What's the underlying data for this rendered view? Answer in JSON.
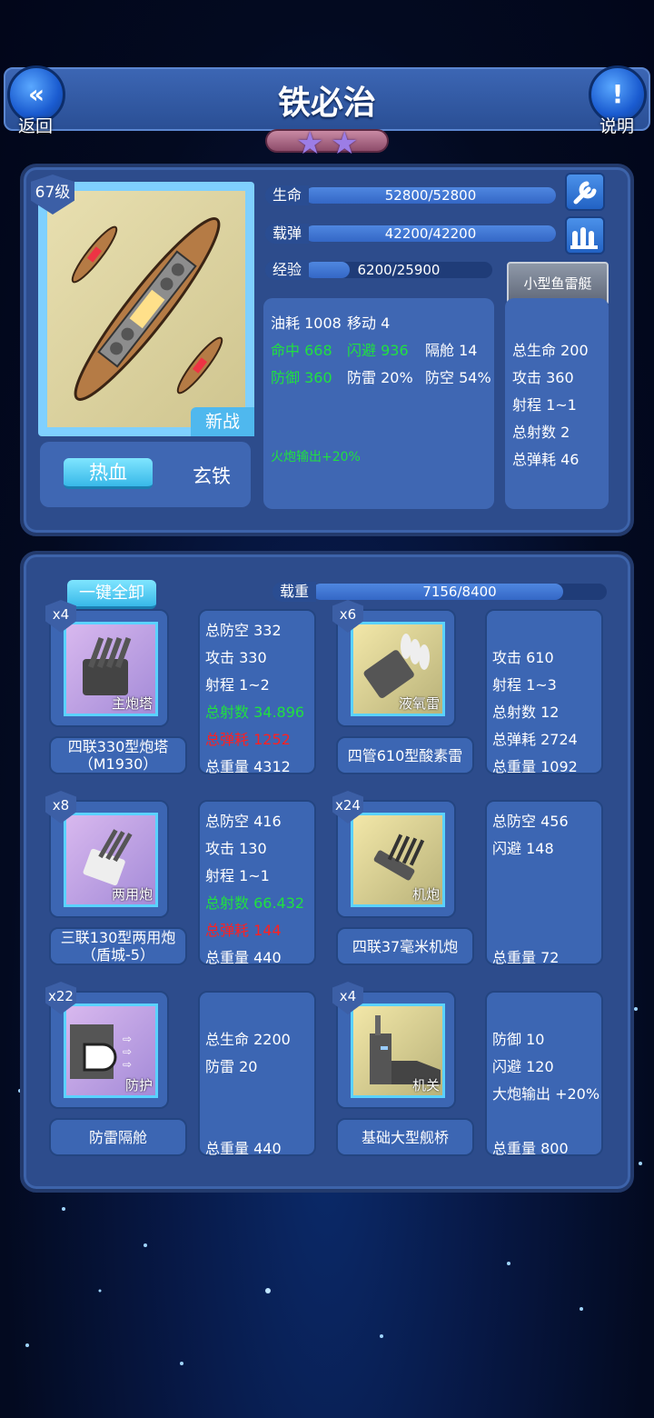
{
  "header": {
    "title": "铁必治",
    "back_label": "返回",
    "help_label": "说明",
    "star_count": 2
  },
  "ship": {
    "level": "67级",
    "tag": "新战",
    "buttons": {
      "active": "热血",
      "other": "玄铁"
    },
    "bars": [
      {
        "label": "生命",
        "value": "52800/52800",
        "ratio": 1.0
      },
      {
        "label": "载弹",
        "value": "42200/42200",
        "ratio": 1.0
      },
      {
        "label": "经验",
        "value": "6200/25900",
        "ratio": 0.24
      }
    ],
    "stats": {
      "fuel": "油耗 1008",
      "move": "移动 4",
      "hit": "命中 668",
      "dodge": "闪避 936",
      "compartment": "隔舱 14",
      "defense": "防御 360",
      "mine_def": "防雷 20%",
      "aa": "防空 54%",
      "bonus": "火炮输出+20%"
    },
    "escort": {
      "button": "小型鱼雷艇",
      "stats": [
        "总生命 200",
        "攻击 360",
        "射程 1~1",
        "总射数 2",
        "总弹耗 46"
      ]
    }
  },
  "equipment": {
    "unload_all": "一键全卸",
    "load_label": "载重",
    "load_value": "7156/8400",
    "load_ratio": 0.852,
    "items": [
      {
        "count": "x4",
        "category": "主炮塔",
        "name": "四联330型炮塔（M1930）",
        "stats": [
          {
            "t": "总防空 332",
            "c": ""
          },
          {
            "t": "攻击 330",
            "c": ""
          },
          {
            "t": "射程 1~2",
            "c": ""
          },
          {
            "t": "总射数 34.896",
            "c": "g"
          },
          {
            "t": "总弹耗 1252",
            "c": "r"
          },
          {
            "t": "总重量 4312",
            "c": ""
          }
        ]
      },
      {
        "count": "x6",
        "category": "液氧雷",
        "name": "四管610型酸素雷",
        "stats": [
          {
            "t": "",
            "c": ""
          },
          {
            "t": "攻击 610",
            "c": ""
          },
          {
            "t": "射程 1~3",
            "c": ""
          },
          {
            "t": "总射数 12",
            "c": ""
          },
          {
            "t": "总弹耗 2724",
            "c": ""
          },
          {
            "t": "总重量 1092",
            "c": ""
          }
        ]
      },
      {
        "count": "x8",
        "category": "两用炮",
        "name": "三联130型两用炮（盾城-5）",
        "stats": [
          {
            "t": "总防空 416",
            "c": ""
          },
          {
            "t": "攻击 130",
            "c": ""
          },
          {
            "t": "射程 1~1",
            "c": ""
          },
          {
            "t": "总射数 66.432",
            "c": "g"
          },
          {
            "t": "总弹耗 144",
            "c": "r"
          },
          {
            "t": "总重量 440",
            "c": ""
          }
        ]
      },
      {
        "count": "x24",
        "category": "机炮",
        "name": "四联37毫米机炮",
        "stats": [
          {
            "t": "总防空 456",
            "c": ""
          },
          {
            "t": "闪避 148",
            "c": ""
          },
          {
            "t": "",
            "c": ""
          },
          {
            "t": "",
            "c": ""
          },
          {
            "t": "",
            "c": ""
          },
          {
            "t": "总重量 72",
            "c": ""
          }
        ]
      },
      {
        "count": "x22",
        "category": "防护",
        "name": "防雷隔舱",
        "stats": [
          {
            "t": "",
            "c": ""
          },
          {
            "t": "总生命 2200",
            "c": ""
          },
          {
            "t": "防雷 20",
            "c": ""
          },
          {
            "t": "",
            "c": ""
          },
          {
            "t": "",
            "c": ""
          },
          {
            "t": "总重量 440",
            "c": ""
          }
        ]
      },
      {
        "count": "x4",
        "category": "机关",
        "name": "基础大型舰桥",
        "stats": [
          {
            "t": "",
            "c": ""
          },
          {
            "t": "防御 10",
            "c": ""
          },
          {
            "t": "闪避 120",
            "c": ""
          },
          {
            "t": "大炮输出 +20%",
            "c": ""
          },
          {
            "t": "",
            "c": ""
          },
          {
            "t": "总重量 800",
            "c": ""
          }
        ]
      }
    ]
  },
  "colors": {
    "green_stat": "#20e040",
    "red_stat": "#ff2020",
    "panel": "#2d4c8c"
  }
}
